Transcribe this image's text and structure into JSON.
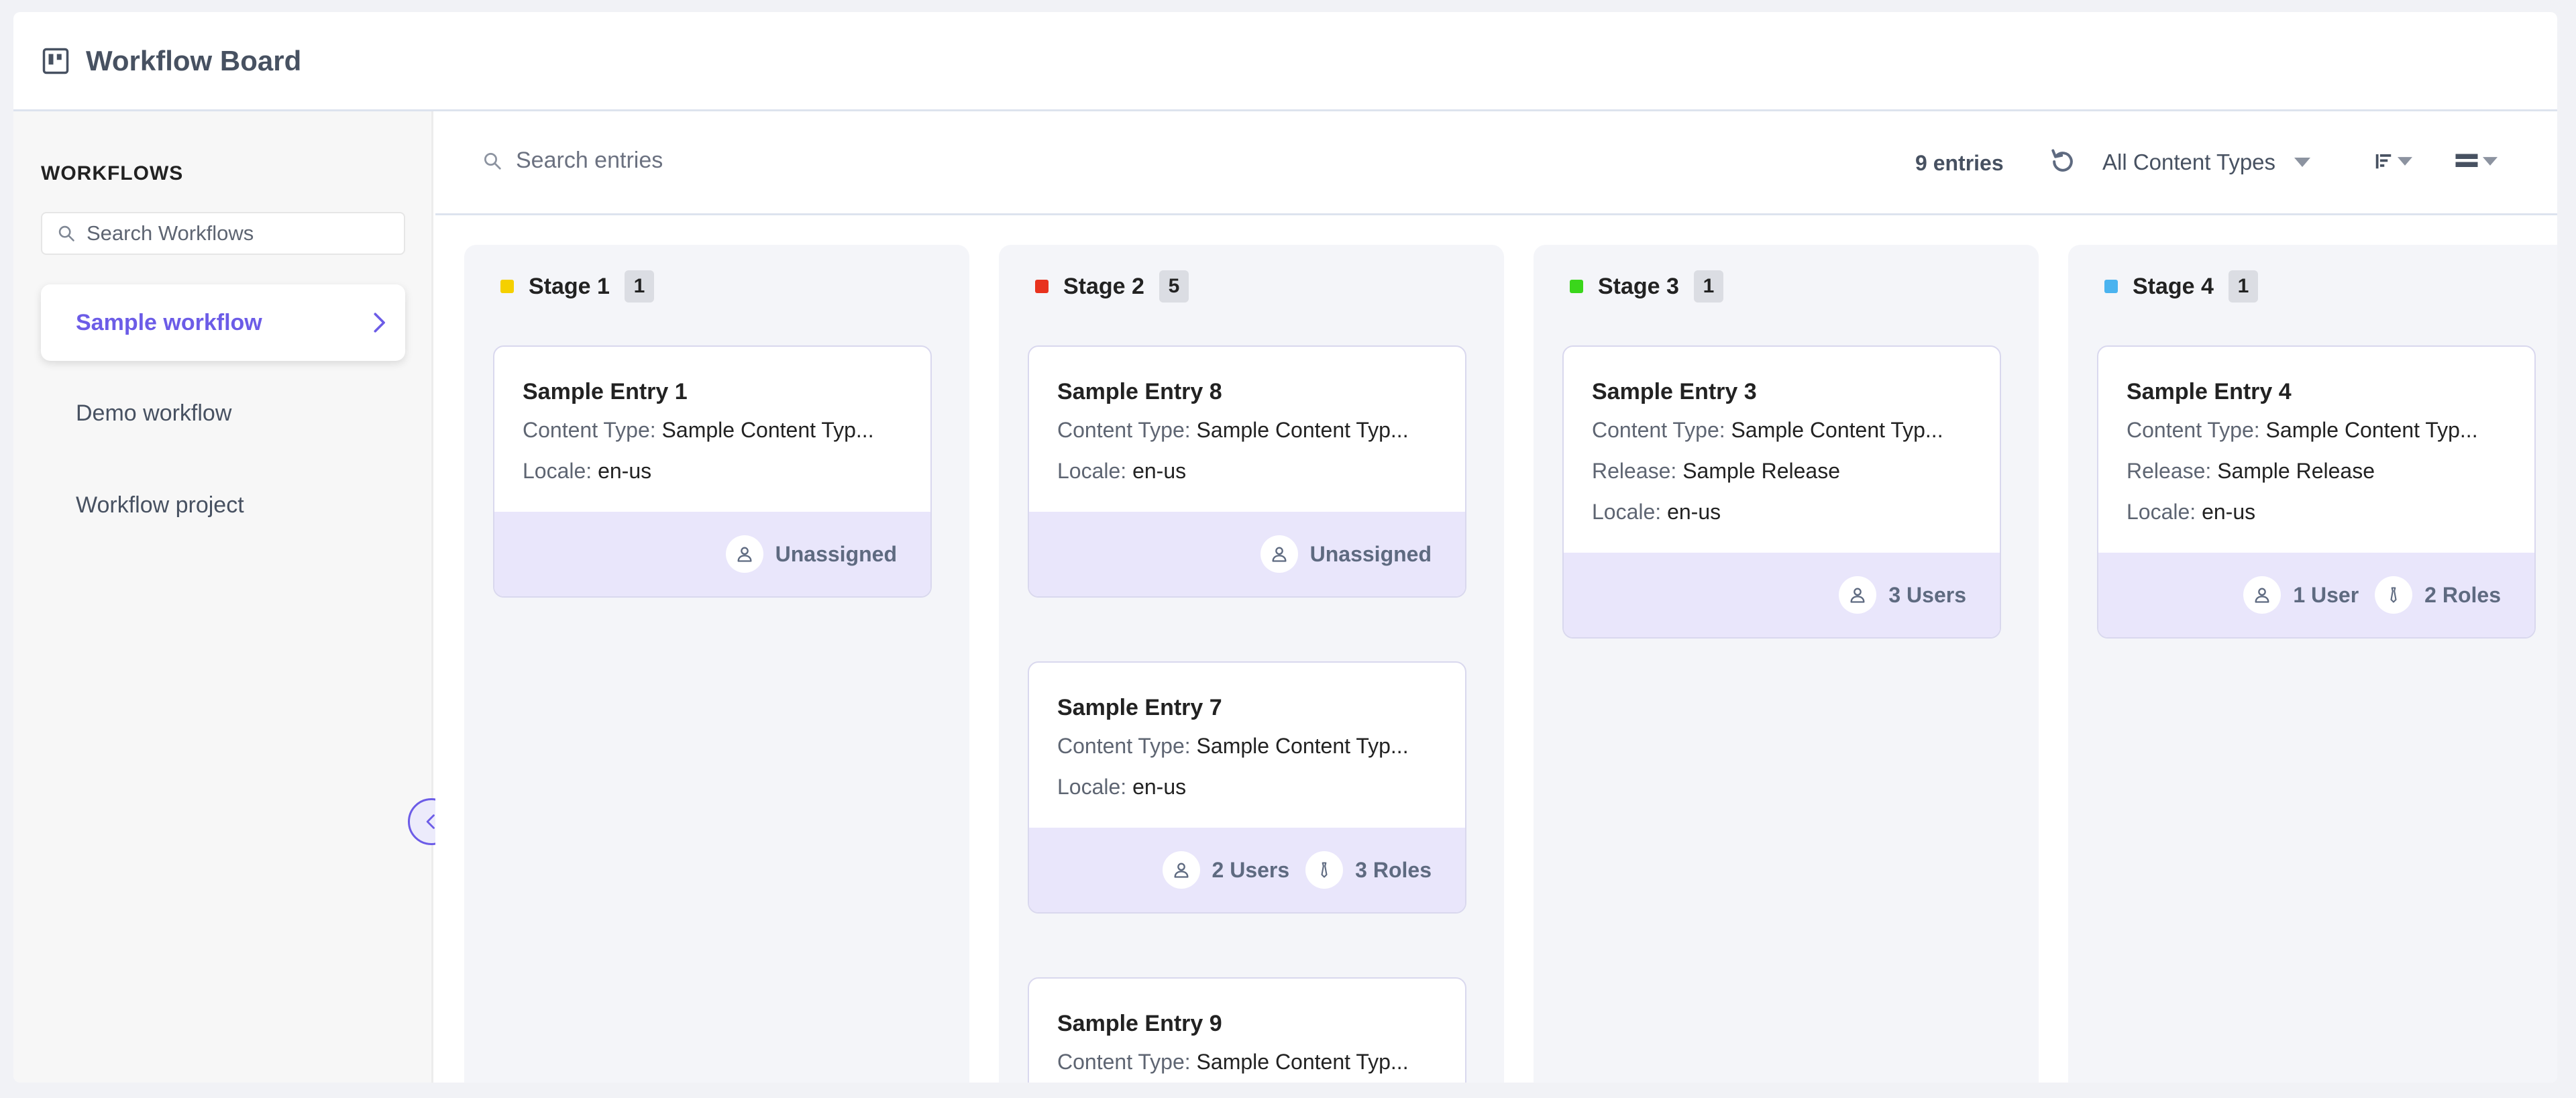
{
  "header": {
    "title": "Workflow Board"
  },
  "sidebar": {
    "heading": "WORKFLOWS",
    "search_placeholder": "Search Workflows",
    "items": [
      {
        "label": "Sample workflow",
        "active": true
      },
      {
        "label": "Demo workflow",
        "active": false
      },
      {
        "label": "Workflow project",
        "active": false
      }
    ]
  },
  "toolbar": {
    "search_placeholder": "Search entries",
    "entries_count": "9 entries",
    "content_type_filter": "All Content Types"
  },
  "colors": {
    "accent": "#6c5ce7",
    "stage1": "#f5d000",
    "stage2": "#e8321e",
    "stage3": "#3ad61b",
    "stage4": "#4ab3ef"
  },
  "columns": [
    {
      "name": "Stage 1",
      "count": "1",
      "cards": [
        {
          "title": "Sample Entry 1",
          "fields": [
            {
              "key": "Content Type:",
              "value": "Sample Content Typ..."
            },
            {
              "key": "Locale:",
              "value": "en-us"
            }
          ],
          "assignees": [
            {
              "icon": "user-icon",
              "label": "Unassigned"
            }
          ]
        }
      ]
    },
    {
      "name": "Stage 2",
      "count": "5",
      "cards": [
        {
          "title": "Sample Entry 8",
          "fields": [
            {
              "key": "Content Type:",
              "value": "Sample Content Typ..."
            },
            {
              "key": "Locale:",
              "value": "en-us"
            }
          ],
          "assignees": [
            {
              "icon": "user-icon",
              "label": "Unassigned"
            }
          ]
        },
        {
          "title": "Sample Entry 7",
          "fields": [
            {
              "key": "Content Type:",
              "value": "Sample Content Typ..."
            },
            {
              "key": "Locale:",
              "value": "en-us"
            }
          ],
          "assignees": [
            {
              "icon": "user-icon",
              "label": "2 Users"
            },
            {
              "icon": "tie-icon",
              "label": "3 Roles"
            }
          ]
        },
        {
          "title": "Sample Entry 9",
          "fields": [
            {
              "key": "Content Type:",
              "value": "Sample Content Typ..."
            }
          ],
          "assignees": []
        }
      ]
    },
    {
      "name": "Stage 3",
      "count": "1",
      "cards": [
        {
          "title": "Sample Entry 3",
          "fields": [
            {
              "key": "Content Type:",
              "value": "Sample Content Typ..."
            },
            {
              "key": "Release:",
              "value": "Sample Release"
            },
            {
              "key": "Locale:",
              "value": "en-us"
            }
          ],
          "assignees": [
            {
              "icon": "user-icon",
              "label": "3 Users"
            }
          ]
        }
      ]
    },
    {
      "name": "Stage 4",
      "count": "1",
      "cards": [
        {
          "title": "Sample Entry 4",
          "fields": [
            {
              "key": "Content Type:",
              "value": "Sample Content Typ..."
            },
            {
              "key": "Release:",
              "value": "Sample Release"
            },
            {
              "key": "Locale:",
              "value": "en-us"
            }
          ],
          "assignees": [
            {
              "icon": "user-icon",
              "label": "1 User"
            },
            {
              "icon": "tie-icon",
              "label": "2 Roles"
            }
          ]
        }
      ]
    }
  ]
}
